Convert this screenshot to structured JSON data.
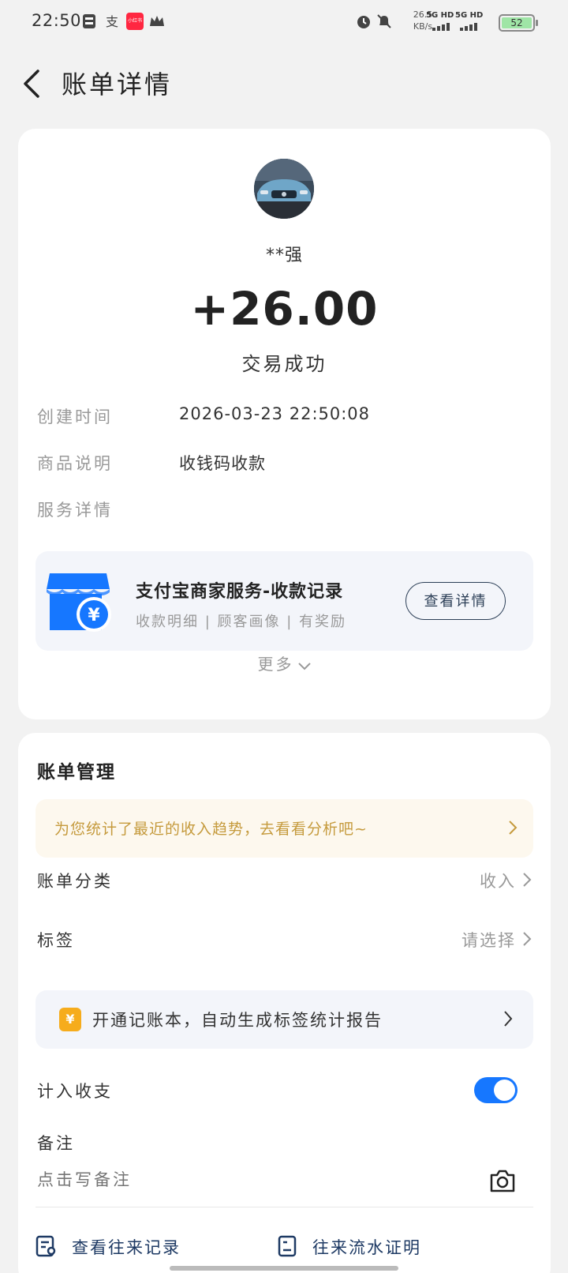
{
  "status_bar": {
    "time": "22:50",
    "net_speed_value": "26.5",
    "net_speed_unit": "KB/s",
    "signal1_label": "5G HD",
    "signal2_label": "5G HD",
    "battery": "52",
    "app_badge_text": "小红书"
  },
  "header": {
    "title": "账单详情",
    "back_icon": "chevron-left-icon"
  },
  "transaction": {
    "payer": "**强",
    "amount": "+26.00",
    "status": "交易成功",
    "rows": [
      {
        "label": "创建时间",
        "value": "2026-03-23 22:50:08"
      },
      {
        "label": "商品说明",
        "value": "收钱码收款"
      },
      {
        "label": "服务详情",
        "value": ""
      }
    ]
  },
  "service": {
    "title": "支付宝商家服务-收款记录",
    "subtitle": "收款明细 | 顾客画像 | 有奖励",
    "button": "查看详情",
    "icon_symbol": "¥",
    "colors": {
      "icon": "#1677ff",
      "button_border": "#2b3e56"
    }
  },
  "more_label": "更多",
  "management": {
    "title": "账单管理",
    "tip": "为您统计了最近的收入趋势，去看看分析吧~",
    "category_label": "账单分类",
    "category_value": "收入",
    "tag_label": "标签",
    "tag_value": "请选择",
    "ledger_text": "开通记账本，自动生成标签统计报告",
    "ledger_icon_symbol": "¥",
    "count_label": "计入收支",
    "count_enabled": true,
    "note_label": "备注",
    "note_placeholder": "点击写备注",
    "link_history": "查看往来记录",
    "link_proof": "往来流水证明",
    "colors": {
      "accent": "#1677ff",
      "tip_text": "#c59a3c",
      "ledger_icon": "#f6ac1c",
      "link": "#1e3a64"
    }
  }
}
